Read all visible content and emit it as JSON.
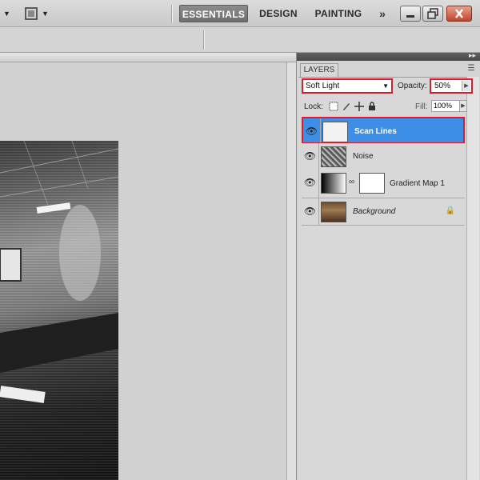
{
  "app": {
    "workspaces": [
      {
        "label": "ESSENTIALS",
        "active": true
      },
      {
        "label": "DESIGN",
        "active": false
      },
      {
        "label": "PAINTING",
        "active": false
      }
    ],
    "more_label": "»",
    "icons": [
      "move-tool-icon",
      "screen-mode-icon",
      "minimize-icon",
      "restore-icon",
      "close-icon"
    ]
  },
  "layers_panel": {
    "tab_label": "LAYERS",
    "blend_mode": "Soft Light",
    "opacity_label": "Opacity:",
    "opacity_value": "50%",
    "lock_label": "Lock:",
    "fill_label": "Fill:",
    "fill_value": "100%",
    "layers": [
      {
        "name": "Scan Lines",
        "selected": true,
        "thumbnail": "white"
      },
      {
        "name": "Noise",
        "selected": false,
        "thumbnail": "noise"
      },
      {
        "name": "Gradient Map 1",
        "selected": false,
        "thumbnail": "gradient",
        "has_mask": true
      },
      {
        "name": "Background",
        "selected": false,
        "thumbnail": "photo",
        "locked": true
      }
    ]
  },
  "colors": {
    "selection": "#3d8ee6",
    "highlight_border": "#e0192b"
  }
}
